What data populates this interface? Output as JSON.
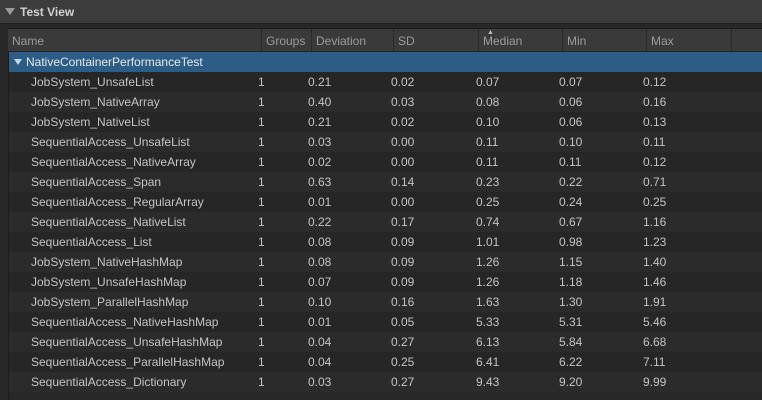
{
  "panel": {
    "title": "Test View"
  },
  "columns": [
    {
      "key": "name",
      "label": "Name"
    },
    {
      "key": "groups",
      "label": "Groups"
    },
    {
      "key": "deviation",
      "label": "Deviation"
    },
    {
      "key": "sd",
      "label": "SD"
    },
    {
      "key": "median",
      "label": "Median",
      "sorted": true
    },
    {
      "key": "min",
      "label": "Min"
    },
    {
      "key": "max",
      "label": "Max"
    }
  ],
  "sort_indicator": "▲",
  "group": {
    "label": "NativeContainerPerformanceTest",
    "expanded": true
  },
  "rows": [
    {
      "name": "JobSystem_UnsafeList",
      "groups": "1",
      "deviation": "0.21",
      "sd": "0.02",
      "median": "0.07",
      "min": "0.07",
      "max": "0.12"
    },
    {
      "name": "JobSystem_NativeArray",
      "groups": "1",
      "deviation": "0.40",
      "sd": "0.03",
      "median": "0.08",
      "min": "0.06",
      "max": "0.16"
    },
    {
      "name": "JobSystem_NativeList",
      "groups": "1",
      "deviation": "0.21",
      "sd": "0.02",
      "median": "0.10",
      "min": "0.06",
      "max": "0.13"
    },
    {
      "name": "SequentialAccess_UnsafeList",
      "groups": "1",
      "deviation": "0.03",
      "sd": "0.00",
      "median": "0.11",
      "min": "0.10",
      "max": "0.11"
    },
    {
      "name": "SequentialAccess_NativeArray",
      "groups": "1",
      "deviation": "0.02",
      "sd": "0.00",
      "median": "0.11",
      "min": "0.11",
      "max": "0.12"
    },
    {
      "name": "SequentialAccess_Span",
      "groups": "1",
      "deviation": "0.63",
      "sd": "0.14",
      "median": "0.23",
      "min": "0.22",
      "max": "0.71"
    },
    {
      "name": "SequentialAccess_RegularArray",
      "groups": "1",
      "deviation": "0.01",
      "sd": "0.00",
      "median": "0.25",
      "min": "0.24",
      "max": "0.25"
    },
    {
      "name": "SequentialAccess_NativeList",
      "groups": "1",
      "deviation": "0.22",
      "sd": "0.17",
      "median": "0.74",
      "min": "0.67",
      "max": "1.16"
    },
    {
      "name": "SequentialAccess_List",
      "groups": "1",
      "deviation": "0.08",
      "sd": "0.09",
      "median": "1.01",
      "min": "0.98",
      "max": "1.23"
    },
    {
      "name": "JobSystem_NativeHashMap",
      "groups": "1",
      "deviation": "0.08",
      "sd": "0.09",
      "median": "1.26",
      "min": "1.15",
      "max": "1.40"
    },
    {
      "name": "JobSystem_UnsafeHashMap",
      "groups": "1",
      "deviation": "0.07",
      "sd": "0.09",
      "median": "1.26",
      "min": "1.18",
      "max": "1.46"
    },
    {
      "name": "JobSystem_ParallelHashMap",
      "groups": "1",
      "deviation": "0.10",
      "sd": "0.16",
      "median": "1.63",
      "min": "1.30",
      "max": "1.91"
    },
    {
      "name": "SequentialAccess_NativeHashMap",
      "groups": "1",
      "deviation": "0.01",
      "sd": "0.05",
      "median": "5.33",
      "min": "5.31",
      "max": "5.46"
    },
    {
      "name": "SequentialAccess_UnsafeHashMap",
      "groups": "1",
      "deviation": "0.04",
      "sd": "0.27",
      "median": "6.13",
      "min": "5.84",
      "max": "6.68"
    },
    {
      "name": "SequentialAccess_ParallelHashMap",
      "groups": "1",
      "deviation": "0.04",
      "sd": "0.25",
      "median": "6.41",
      "min": "6.22",
      "max": "7.11"
    },
    {
      "name": "SequentialAccess_Dictionary",
      "groups": "1",
      "deviation": "0.03",
      "sd": "0.27",
      "median": "9.43",
      "min": "9.20",
      "max": "9.99"
    }
  ]
}
